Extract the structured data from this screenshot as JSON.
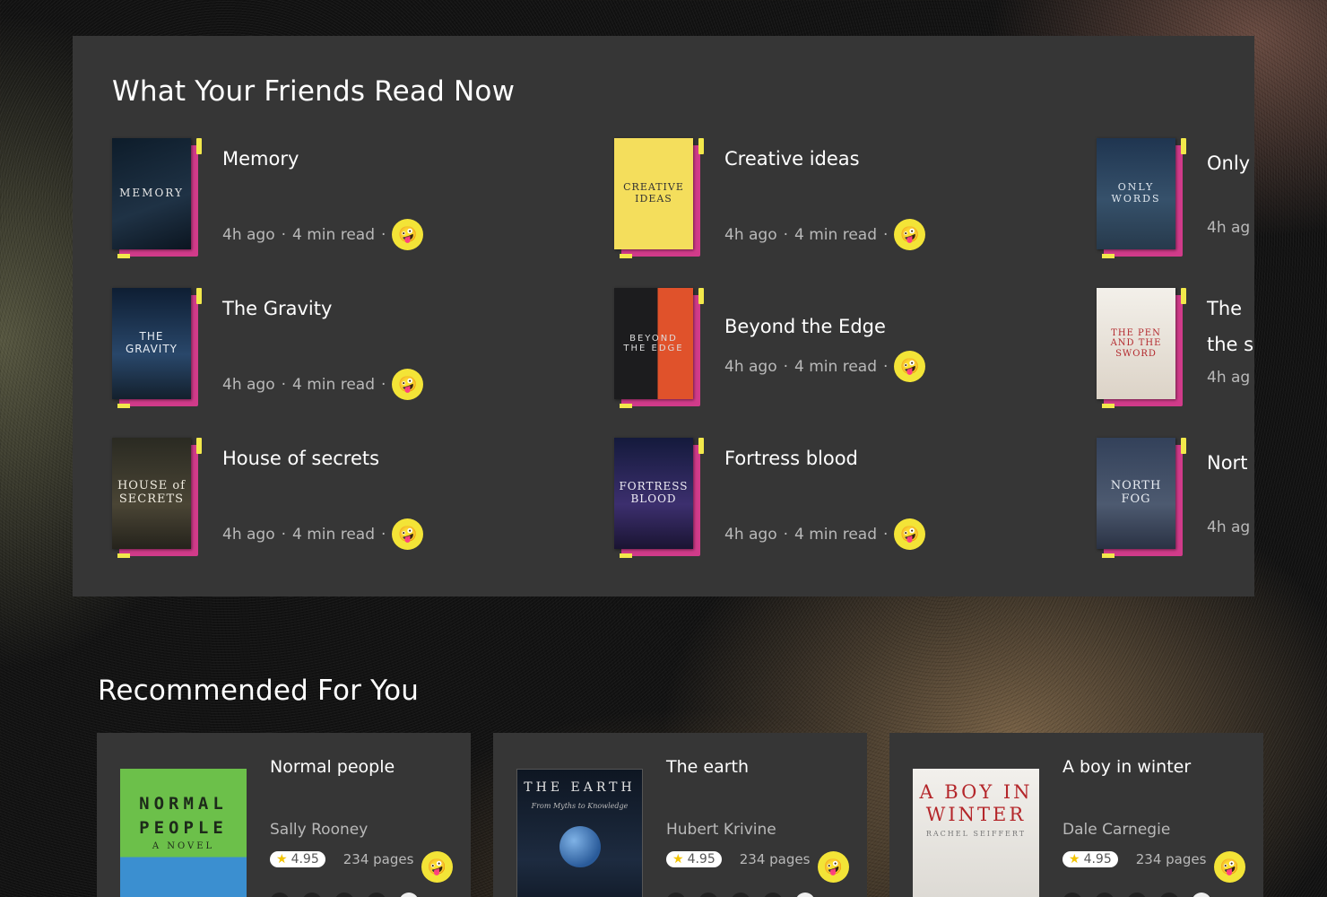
{
  "friends": {
    "section_title": "What Your Friends Read Now",
    "items": [
      {
        "title": "Memory",
        "time": "4h ago",
        "read": "4 min read",
        "cover_text": "MEMORY"
      },
      {
        "title": "Creative ideas",
        "time": "4h ago",
        "read": "4 min read",
        "cover_text": "CREATIVE IDEAS"
      },
      {
        "title": "Only",
        "time": "4h ag",
        "read": "",
        "cover_text": "ONLY WORDS"
      },
      {
        "title": "The Gravity",
        "time": "4h ago",
        "read": "4 min read",
        "cover_text": "THE GRAVITY"
      },
      {
        "title": "Beyond the Edge",
        "time": "4h ago",
        "read": "4 min read",
        "cover_text": "BEYOND THE EDGE"
      },
      {
        "title": "The",
        "title_line2": "the s",
        "time": "4h ag",
        "read": "",
        "cover_text": "THE PEN AND THE SWORD"
      },
      {
        "title": "House of secrets",
        "time": "4h ago",
        "read": "4 min read",
        "cover_text": "HOUSE of SECRETS"
      },
      {
        "title": "Fortress blood",
        "time": "4h ago",
        "read": "4 min read",
        "cover_text": "FORTRESS BLOOD"
      },
      {
        "title": "Nort",
        "time": "4h ag",
        "read": "",
        "cover_text": "NORTH FOG"
      }
    ]
  },
  "recommended": {
    "section_title": "Recommended For You",
    "items": [
      {
        "title": "Normal people",
        "author": "Sally Rooney",
        "rating": "4.95",
        "pages": "234 pages",
        "cover_text": "NORMAL PEOPLE",
        "cover_sub": "A NOVEL"
      },
      {
        "title": "The earth",
        "author": "Hubert Krivine",
        "rating": "4.95",
        "pages": "234 pages",
        "cover_text": "THE EARTH",
        "cover_sub": "From Myths to Knowledge"
      },
      {
        "title": "A boy in winter",
        "author": "Dale Carnegie",
        "rating": "4.95",
        "pages": "234 pages",
        "cover_text": "A BOY IN WINTER",
        "cover_sub": "RACHEL SEIFFERT"
      }
    ]
  },
  "icons": {
    "reaction": "🤪",
    "star": "★"
  },
  "colors": {
    "panel": "#363636",
    "accent_pink": "#d13b8a",
    "accent_yellow": "#f2e84b",
    "badge_yellow": "#f3e437"
  }
}
